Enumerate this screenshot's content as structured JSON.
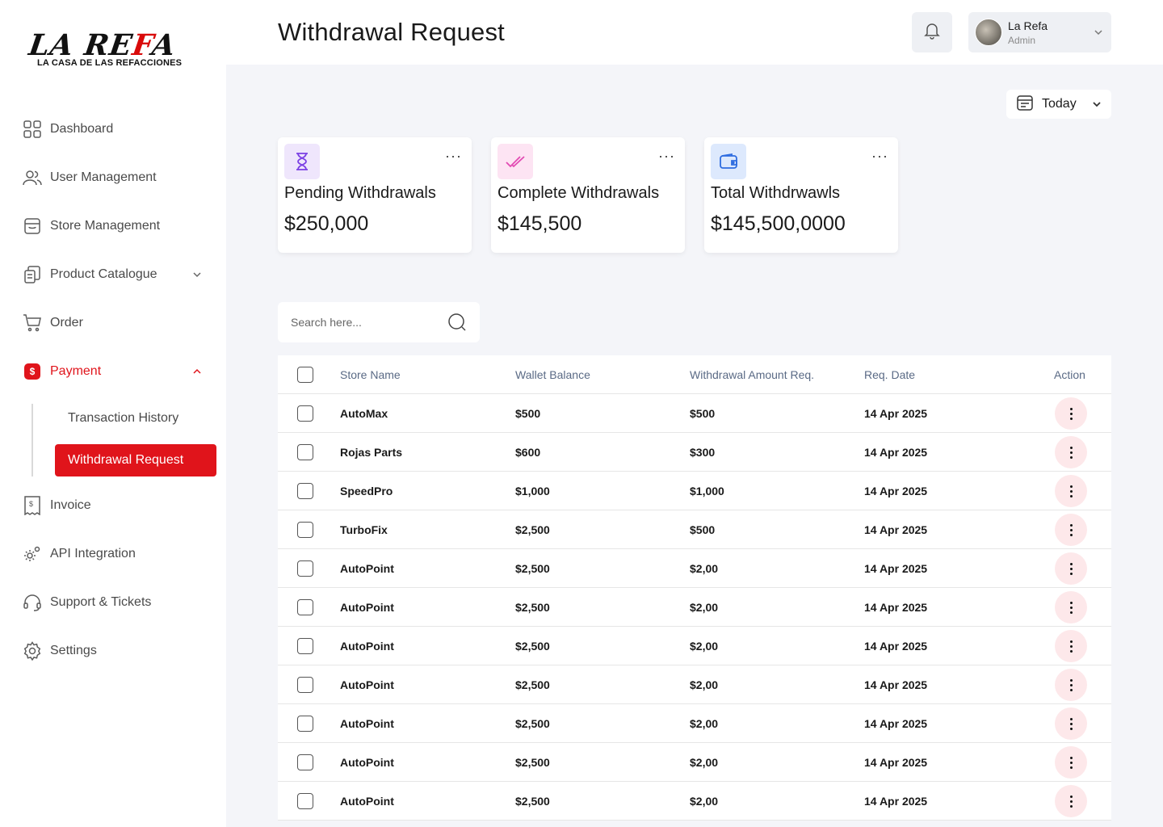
{
  "brand": {
    "logo_text_black": "LA RE",
    "logo_text_red": "F",
    "logo_text_end": "A",
    "tagline": "LA CASA DE LAS REFACCIONES",
    "accent": "#e0141b"
  },
  "sidebar": {
    "items": [
      {
        "label": "Dashboard"
      },
      {
        "label": "User Management"
      },
      {
        "label": "Store Management"
      },
      {
        "label": "Product Catalogue"
      },
      {
        "label": "Order"
      },
      {
        "label": "Payment",
        "badge": "$"
      },
      {
        "label": "Invoice"
      },
      {
        "label": "API Integration"
      },
      {
        "label": "Support & Tickets"
      },
      {
        "label": "Settings"
      }
    ],
    "payment_sub": {
      "history": "Transaction History",
      "withdrawal": "Withdrawal Request"
    }
  },
  "header": {
    "title": "Withdrawal Request",
    "user_name": "La Refa",
    "user_role": "Admin"
  },
  "date_filter": {
    "label": "Today"
  },
  "cards": [
    {
      "title": "Pending Withdrawals",
      "value": "$250,000",
      "icon": "hourglass-icon",
      "color": "#efe6fc"
    },
    {
      "title": "Complete Withdrawals",
      "value": "$145,500",
      "icon": "double-check-icon",
      "color": "#fde4f3"
    },
    {
      "title": "Total Withdrwawls",
      "value": "$145,500,0000",
      "icon": "wallet-icon",
      "color": "#dde9fd"
    }
  ],
  "search": {
    "placeholder": "Search here..."
  },
  "table": {
    "headers": {
      "store": "Store Name",
      "wallet": "Wallet Balance",
      "amount": "Withdrawal Amount Req.",
      "date": "Req. Date",
      "action": "Action"
    },
    "rows": [
      {
        "store": "AutoMax",
        "wallet": "$500",
        "amount": "$500",
        "date": "14 Apr 2025"
      },
      {
        "store": "Rojas Parts",
        "wallet": "$600",
        "amount": "$300",
        "date": "14 Apr 2025"
      },
      {
        "store": "SpeedPro",
        "wallet": "$1,000",
        "amount": "$1,000",
        "date": "14 Apr 2025"
      },
      {
        "store": "TurboFix",
        "wallet": "$2,500",
        "amount": "$500",
        "date": "14 Apr 2025"
      },
      {
        "store": "AutoPoint",
        "wallet": "$2,500",
        "amount": "$2,00",
        "date": "14 Apr 2025"
      },
      {
        "store": "AutoPoint",
        "wallet": "$2,500",
        "amount": "$2,00",
        "date": "14 Apr 2025"
      },
      {
        "store": "AutoPoint",
        "wallet": "$2,500",
        "amount": "$2,00",
        "date": "14 Apr 2025"
      },
      {
        "store": "AutoPoint",
        "wallet": "$2,500",
        "amount": "$2,00",
        "date": "14 Apr 2025"
      },
      {
        "store": "AutoPoint",
        "wallet": "$2,500",
        "amount": "$2,00",
        "date": "14 Apr 2025"
      },
      {
        "store": "AutoPoint",
        "wallet": "$2,500",
        "amount": "$2,00",
        "date": "14 Apr 2025"
      },
      {
        "store": "AutoPoint",
        "wallet": "$2,500",
        "amount": "$2,00",
        "date": "14 Apr 2025"
      }
    ]
  }
}
